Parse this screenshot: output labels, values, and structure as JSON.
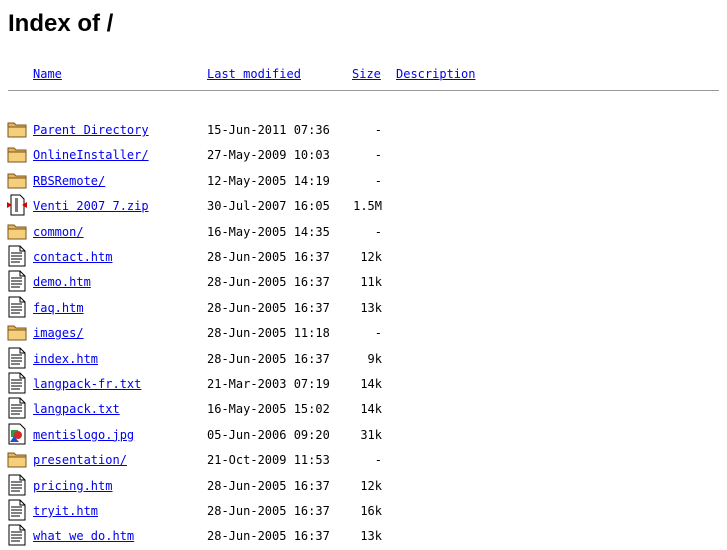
{
  "page": {
    "title": "Index of /"
  },
  "columns": {
    "name": "Name",
    "last_modified": "Last modified",
    "size": "Size",
    "description": "Description"
  },
  "rows": [
    {
      "name": "Parent Directory",
      "modified": "15-Jun-2011 07:36",
      "size": "-",
      "icon": "folder-icon"
    },
    {
      "name": "OnlineInstaller/",
      "modified": "27-May-2009 10:03",
      "size": "-",
      "icon": "folder-icon"
    },
    {
      "name": "RBSRemote/",
      "modified": "12-May-2005 14:19",
      "size": "-",
      "icon": "folder-icon"
    },
    {
      "name": "Venti 2007 7.zip",
      "modified": "30-Jul-2007 16:05",
      "size": "1.5M",
      "icon": "archive-icon"
    },
    {
      "name": "common/",
      "modified": "16-May-2005 14:35",
      "size": "-",
      "icon": "folder-icon"
    },
    {
      "name": "contact.htm",
      "modified": "28-Jun-2005 16:37",
      "size": "12k",
      "icon": "text-file-icon"
    },
    {
      "name": "demo.htm",
      "modified": "28-Jun-2005 16:37",
      "size": "11k",
      "icon": "text-file-icon"
    },
    {
      "name": "faq.htm",
      "modified": "28-Jun-2005 16:37",
      "size": "13k",
      "icon": "text-file-icon"
    },
    {
      "name": "images/",
      "modified": "28-Jun-2005 11:18",
      "size": "-",
      "icon": "folder-icon"
    },
    {
      "name": "index.htm",
      "modified": "28-Jun-2005 16:37",
      "size": "9k",
      "icon": "text-file-icon"
    },
    {
      "name": "langpack-fr.txt",
      "modified": "21-Mar-2003 07:19",
      "size": "14k",
      "icon": "text-file-icon"
    },
    {
      "name": "langpack.txt",
      "modified": "16-May-2005 15:02",
      "size": "14k",
      "icon": "text-file-icon"
    },
    {
      "name": "mentislogo.jpg",
      "modified": "05-Jun-2006 09:20",
      "size": "31k",
      "icon": "image-file-icon"
    },
    {
      "name": "presentation/",
      "modified": "21-Oct-2009 11:53",
      "size": "-",
      "icon": "folder-icon"
    },
    {
      "name": "pricing.htm",
      "modified": "28-Jun-2005 16:37",
      "size": "12k",
      "icon": "text-file-icon"
    },
    {
      "name": "tryit.htm",
      "modified": "28-Jun-2005 16:37",
      "size": "16k",
      "icon": "text-file-icon"
    },
    {
      "name": "what we do.htm",
      "modified": "28-Jun-2005 16:37",
      "size": "13k",
      "icon": "text-file-icon"
    }
  ]
}
